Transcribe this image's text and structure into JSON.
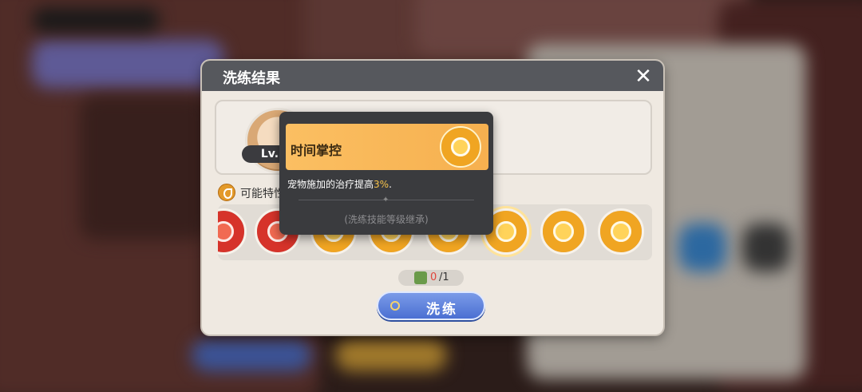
{
  "dialog": {
    "title": "洗练结果",
    "close_symbol": "✕",
    "traits_label": "可能特性",
    "pet_level_label": "Lv."
  },
  "skills": [
    {
      "color": "red",
      "icon": "red-skill-icon"
    },
    {
      "color": "red",
      "icon": "red-skill-icon"
    },
    {
      "color": "gold",
      "icon": "gold-skill-icon"
    },
    {
      "color": "gold",
      "icon": "gold-skill-icon"
    },
    {
      "color": "gold",
      "icon": "gold-skill-icon"
    },
    {
      "color": "gold",
      "icon": "time-mastery-icon",
      "selected": true
    },
    {
      "color": "gold",
      "icon": "flame-icon"
    },
    {
      "color": "gold",
      "icon": "star-burst-icon"
    }
  ],
  "cost": {
    "current": "0",
    "total": "/1"
  },
  "refine_button": {
    "label": "洗练"
  },
  "tooltip": {
    "skill_name": "时间掌控",
    "desc_prefix": "宠物施加的治疗提高",
    "desc_value": "3%",
    "desc_suffix": ".",
    "note": "(洗练技能等级继承)"
  },
  "colors": {
    "title_bar": "#56585d",
    "tooltip_header": "#fbbf62",
    "button": "#4a6fd2",
    "highlight": "#f6c24a"
  }
}
